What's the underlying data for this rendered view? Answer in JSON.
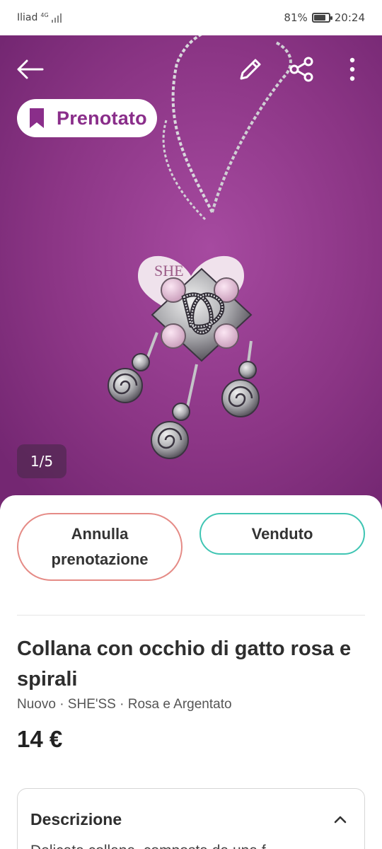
{
  "status_bar": {
    "carrier": "Iliad",
    "network": "4G",
    "battery": "81%",
    "battery_level": 0.81,
    "time": "20:24"
  },
  "toolbar": {
    "back_icon": "arrow-left-icon",
    "edit_icon": "pencil-icon",
    "share_icon": "share-icon",
    "more_icon": "more-vertical-icon"
  },
  "badge": {
    "label": "Prenotato",
    "icon": "bookmark-icon",
    "color": "#8a2e8a"
  },
  "gallery": {
    "counter": "1/5"
  },
  "actions": {
    "cancel_label": "Annulla prenotazione",
    "cancel_color": "#e58b86",
    "sold_label": "Venduto",
    "sold_color": "#3fc5b3"
  },
  "item": {
    "title": "Collana con occhio di gatto rosa e spirali",
    "meta": "Nuovo · SHE'SS  · Rosa e Argentato",
    "price": "14 €"
  },
  "description": {
    "header": "Descrizione",
    "chevron_icon": "chevron-up-icon",
    "text": "Delicata collana, composta da una f"
  }
}
